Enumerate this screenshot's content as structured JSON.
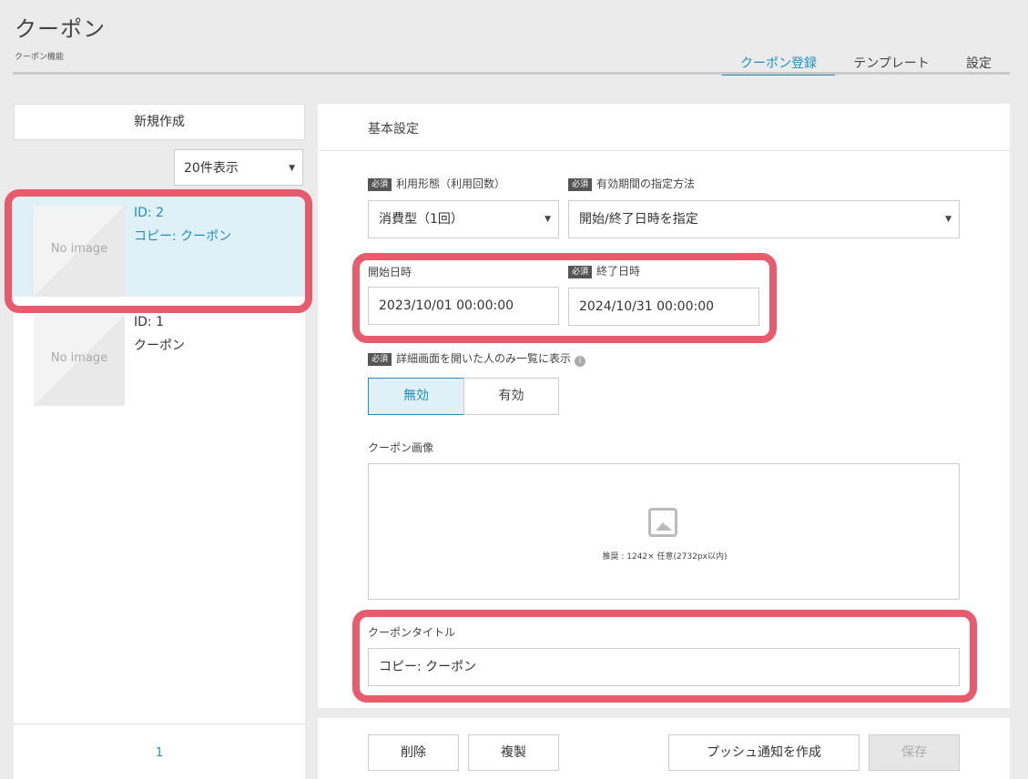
{
  "header": {
    "title": "クーポン",
    "subtitle": "クーポン機能",
    "tabs": [
      {
        "label": "クーポン登録",
        "active": true
      },
      {
        "label": "テンプレート",
        "active": false
      },
      {
        "label": "設定",
        "active": false
      }
    ]
  },
  "sidebar": {
    "new_button": "新規作成",
    "per_page": "20件表示",
    "items": [
      {
        "id_label": "ID: 2",
        "name": "コピー: クーポン",
        "thumb_text": "No image",
        "selected": true
      },
      {
        "id_label": "ID: 1",
        "name": "クーポン",
        "thumb_text": "No image",
        "selected": false
      }
    ],
    "page_number": "1"
  },
  "form": {
    "section_title": "基本設定",
    "required_badge": "必須",
    "usage_type": {
      "label": "利用形態（利用回数）",
      "value": "消費型（1回）"
    },
    "period_method": {
      "label": "有効期間の指定方法",
      "value": "開始/終了日時を指定"
    },
    "start_datetime": {
      "label": "開始日時",
      "value": "2023/10/01 00:00:00"
    },
    "end_datetime": {
      "label": "終了日時",
      "value": "2024/10/31 00:00:00"
    },
    "display_only_opened": {
      "label": "詳細画面を開いた人のみ一覧に表示",
      "info_icon": "i",
      "options": [
        "無効",
        "有効"
      ],
      "selected": "無効"
    },
    "coupon_image": {
      "label": "クーポン画像",
      "hint": "推奨 : 1242× 任意(2732px以内)"
    },
    "coupon_title": {
      "label": "クーポンタイトル",
      "value": "コピー: クーポン"
    }
  },
  "actions": {
    "delete": "削除",
    "duplicate": "複製",
    "push": "プッシュ通知を作成",
    "save": "保存"
  },
  "colors": {
    "accent": "#1c8fc0",
    "highlight": "#e85b6d"
  }
}
